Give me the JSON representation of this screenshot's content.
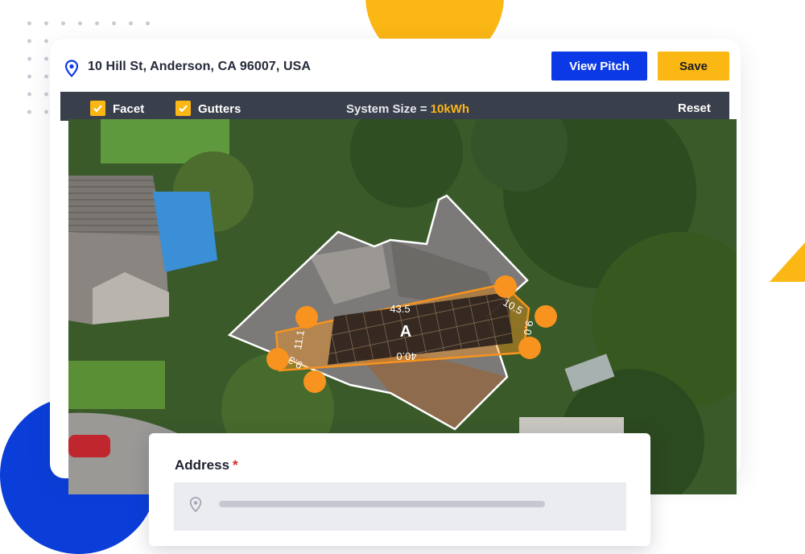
{
  "header": {
    "address": "10 Hill St, Anderson, CA 96007, USA",
    "address_icon": "location-pin-icon",
    "view_pitch_label": "View Pitch",
    "save_label": "Save"
  },
  "toolbar": {
    "facet_label": "Facet",
    "facet_checked": true,
    "gutters_label": "Gutters",
    "gutters_checked": true,
    "system_size_label": "System Size =",
    "system_size_value": "10kWh",
    "reset_label": "Reset"
  },
  "map": {
    "facet_letter": "A",
    "measurements": {
      "top_edge": "43.5",
      "bottom_edge": "40.0",
      "left_edge": "11.1",
      "right_top": "10.5",
      "right_edge": "9.0",
      "left_bottom": "9.3"
    }
  },
  "form": {
    "address_label": "Address",
    "required_mark": "*",
    "address_field_icon": "location-pin-icon"
  },
  "colors": {
    "accent_blue": "#0c39e6",
    "accent_yellow": "#fbb714",
    "facet_orange": "#f7931e",
    "toolbar_bg": "#3a3f4c"
  }
}
